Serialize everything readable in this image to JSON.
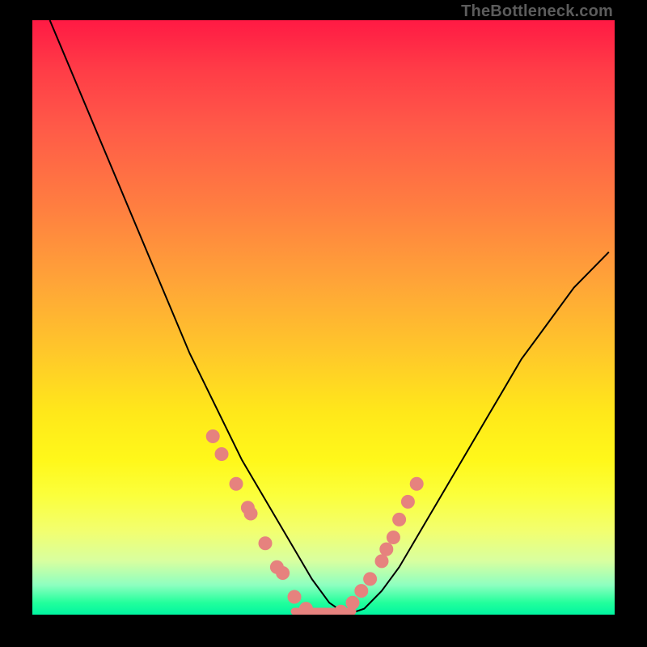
{
  "attribution": "TheBottleneck.com",
  "colors": {
    "page_background": "#000000",
    "gradient_top": "#ff1a44",
    "gradient_bottom": "#00f5a0",
    "curve": "#000000",
    "marker": "#e6827e",
    "attribution_text": "#5c5c5c"
  },
  "chart_data": {
    "type": "line",
    "title": "",
    "xlabel": "",
    "ylabel": "",
    "xlim": [
      0,
      100
    ],
    "ylim": [
      0,
      100
    ],
    "x": [
      3,
      6,
      9,
      12,
      15,
      18,
      21,
      24,
      27,
      30,
      33,
      36,
      39,
      42,
      45,
      48,
      51,
      54,
      57,
      60,
      63,
      66,
      69,
      72,
      75,
      78,
      81,
      84,
      87,
      90,
      93,
      96,
      99
    ],
    "values": [
      100,
      93,
      86,
      79,
      72,
      65,
      58,
      51,
      44,
      38,
      32,
      26,
      21,
      16,
      11,
      6,
      2,
      0,
      1,
      4,
      8,
      13,
      18,
      23,
      28,
      33,
      38,
      43,
      47,
      51,
      55,
      58,
      61
    ],
    "markers": {
      "x": [
        31,
        32.5,
        35,
        37,
        37.5,
        40,
        42,
        43,
        45,
        47,
        50,
        53,
        55,
        56.5,
        58,
        60,
        60.8,
        62,
        63,
        64.5,
        66
      ],
      "y": [
        30,
        27,
        22,
        18,
        17,
        12,
        8,
        7,
        3,
        1,
        0,
        0.5,
        2,
        4,
        6,
        9,
        11,
        13,
        16,
        19,
        22
      ]
    },
    "flat_bottom_range": [
      45,
      55
    ],
    "grid": false,
    "legend": false
  }
}
